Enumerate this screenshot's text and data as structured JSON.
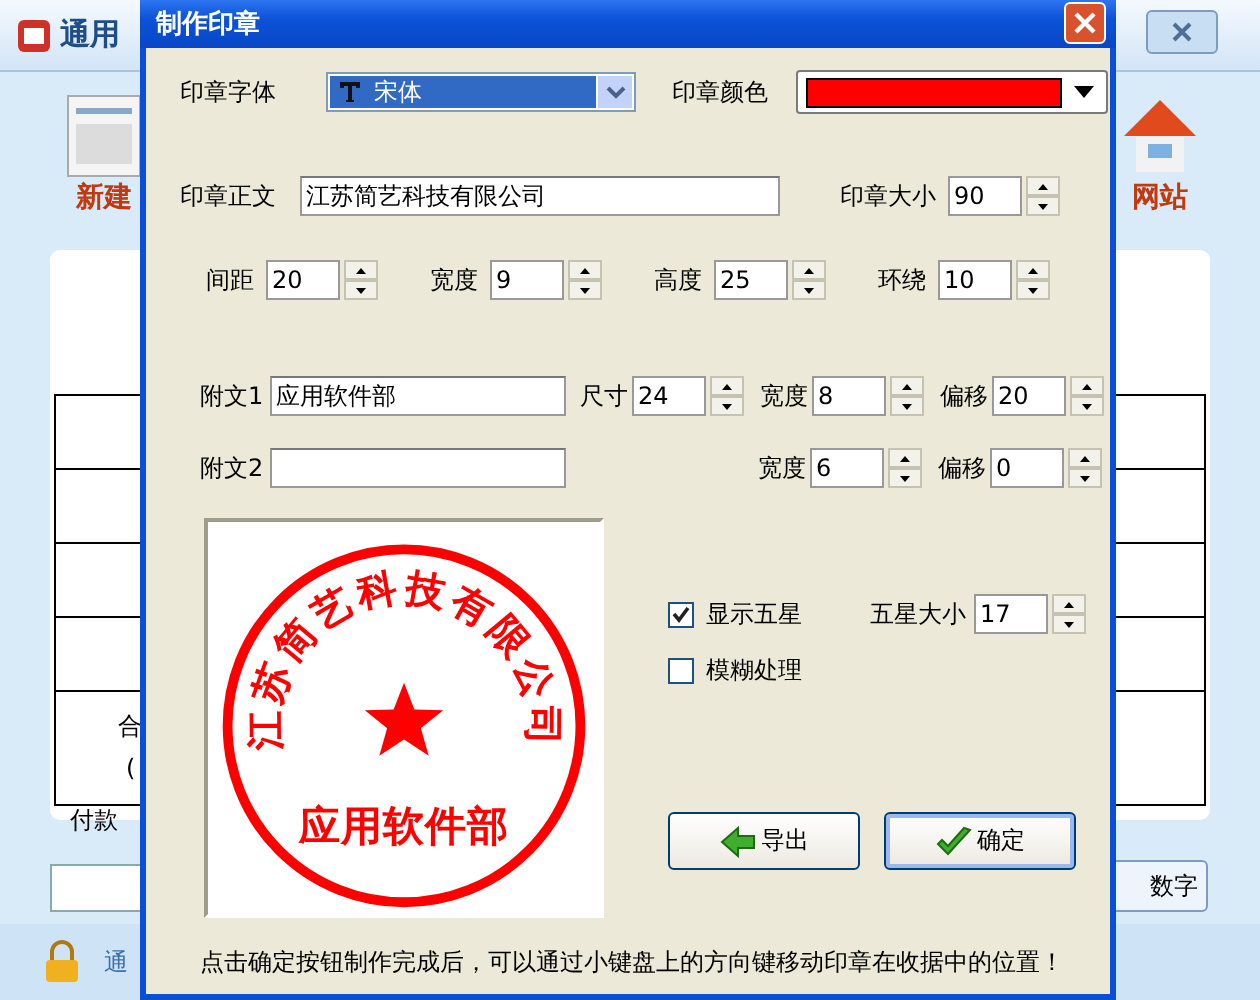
{
  "background_window": {
    "title": "通用",
    "toolbar": [
      {
        "label": "新建",
        "kind": "doc"
      },
      {
        "label": "网站",
        "kind": "house"
      }
    ],
    "table_cells": [
      "合",
      "(",
      "付款"
    ],
    "button": "数字",
    "status": "通"
  },
  "dialog": {
    "title": "制作印章",
    "font": {
      "label": "印章字体",
      "value": "宋体"
    },
    "color": {
      "label": "印章颜色",
      "color": "#ff0000"
    },
    "text": {
      "label": "印章正文",
      "value": "江苏简艺科技有限公司"
    },
    "size": {
      "label": "印章大小",
      "value": "90"
    },
    "params": [
      {
        "label": "间距",
        "value": "20"
      },
      {
        "label": "宽度",
        "value": "9"
      },
      {
        "label": "高度",
        "value": "25"
      },
      {
        "label": "环绕",
        "value": "10"
      }
    ],
    "sub_rows": [
      {
        "label": "附文1",
        "value": "应用软件部",
        "fields": [
          {
            "label": "尺寸",
            "value": "24"
          },
          {
            "label": "宽度",
            "value": "8"
          },
          {
            "label": "偏移",
            "value": "20"
          }
        ]
      },
      {
        "label": "附文2",
        "fields": [
          {
            "label": "宽度",
            "value": "6"
          },
          {
            "label": "偏移",
            "value": "0"
          }
        ]
      }
    ],
    "preview": {
      "ring_text": "江苏简艺科技有限公司",
      "bottom_text": "应用软件部"
    },
    "show_star": {
      "label": "显示五星",
      "checked": true
    },
    "star_size": {
      "label": "五星大小",
      "value": "17"
    },
    "blur": {
      "label": "模糊处理",
      "checked": false
    },
    "buttons": [
      {
        "label": "导出",
        "kind": "export",
        "selected": false
      },
      {
        "label": "确定",
        "kind": "ok",
        "selected": true
      }
    ],
    "hint": "点击确定按钮制作完成后，可以通过小键盘上的方向键移动印章在收据中的位置！"
  }
}
